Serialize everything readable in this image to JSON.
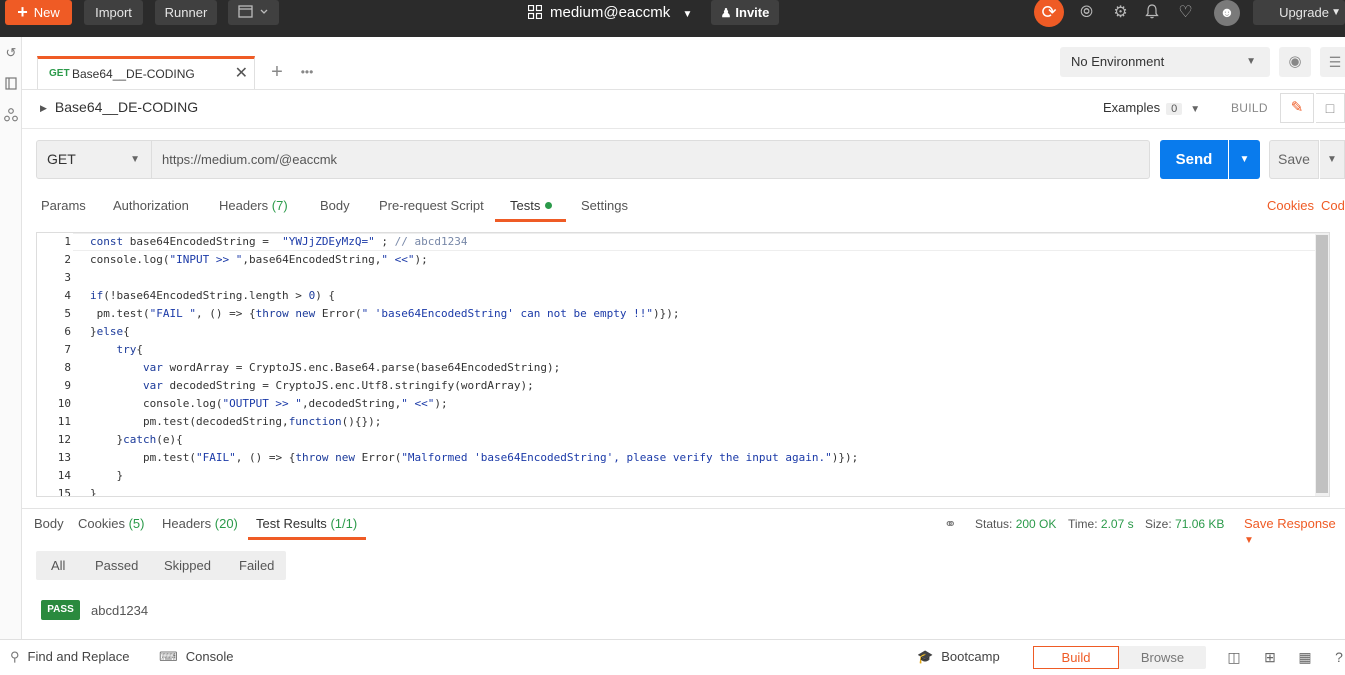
{
  "topbar": {
    "new_label": "New",
    "import_label": "Import",
    "runner_label": "Runner",
    "workspace": "medium@eaccmk",
    "invite_label": "Invite",
    "upgrade_label": "Upgrade"
  },
  "tab": {
    "method": "GET",
    "name": "Base64__DE-CODING"
  },
  "environment": {
    "selected": "No Environment"
  },
  "request": {
    "title": "Base64__DE-CODING",
    "examples_label": "Examples",
    "examples_count": "0",
    "build_label": "BUILD",
    "method": "GET",
    "url": "https://medium.com/@eaccmk",
    "send_label": "Send",
    "save_label": "Save"
  },
  "request_tabs": {
    "params": "Params",
    "authorization": "Authorization",
    "headers": "Headers",
    "headers_count": "(7)",
    "body": "Body",
    "pre_request": "Pre-request Script",
    "tests": "Tests",
    "settings": "Settings",
    "cookies": "Cookies",
    "code": "Code"
  },
  "editor": {
    "line_numbers": [
      "1",
      "2",
      "3",
      "4",
      "5",
      "6",
      "7",
      "8",
      "9",
      "10",
      "11",
      "12",
      "13",
      "14",
      "15"
    ]
  },
  "response": {
    "tabs": {
      "body": "Body",
      "cookies": "Cookies",
      "cookies_count": "(5)",
      "headers": "Headers",
      "headers_count": "(20)",
      "test_results": "Test Results",
      "test_results_count": "(1/1)"
    },
    "status_label": "Status:",
    "status_value": "200 OK",
    "time_label": "Time:",
    "time_value": "2.07 s",
    "size_label": "Size:",
    "size_value": "71.06 KB",
    "save_response": "Save Response",
    "filters": [
      "All",
      "Passed",
      "Skipped",
      "Failed"
    ],
    "results": [
      {
        "status": "PASS",
        "name": "abcd1234"
      }
    ]
  },
  "bottombar": {
    "find_replace": "Find and Replace",
    "console": "Console",
    "bootcamp": "Bootcamp",
    "build": "Build",
    "browse": "Browse"
  },
  "colors": {
    "accent": "#ef5b25",
    "send_blue": "#097bed",
    "success_green": "#2b9a4a"
  }
}
